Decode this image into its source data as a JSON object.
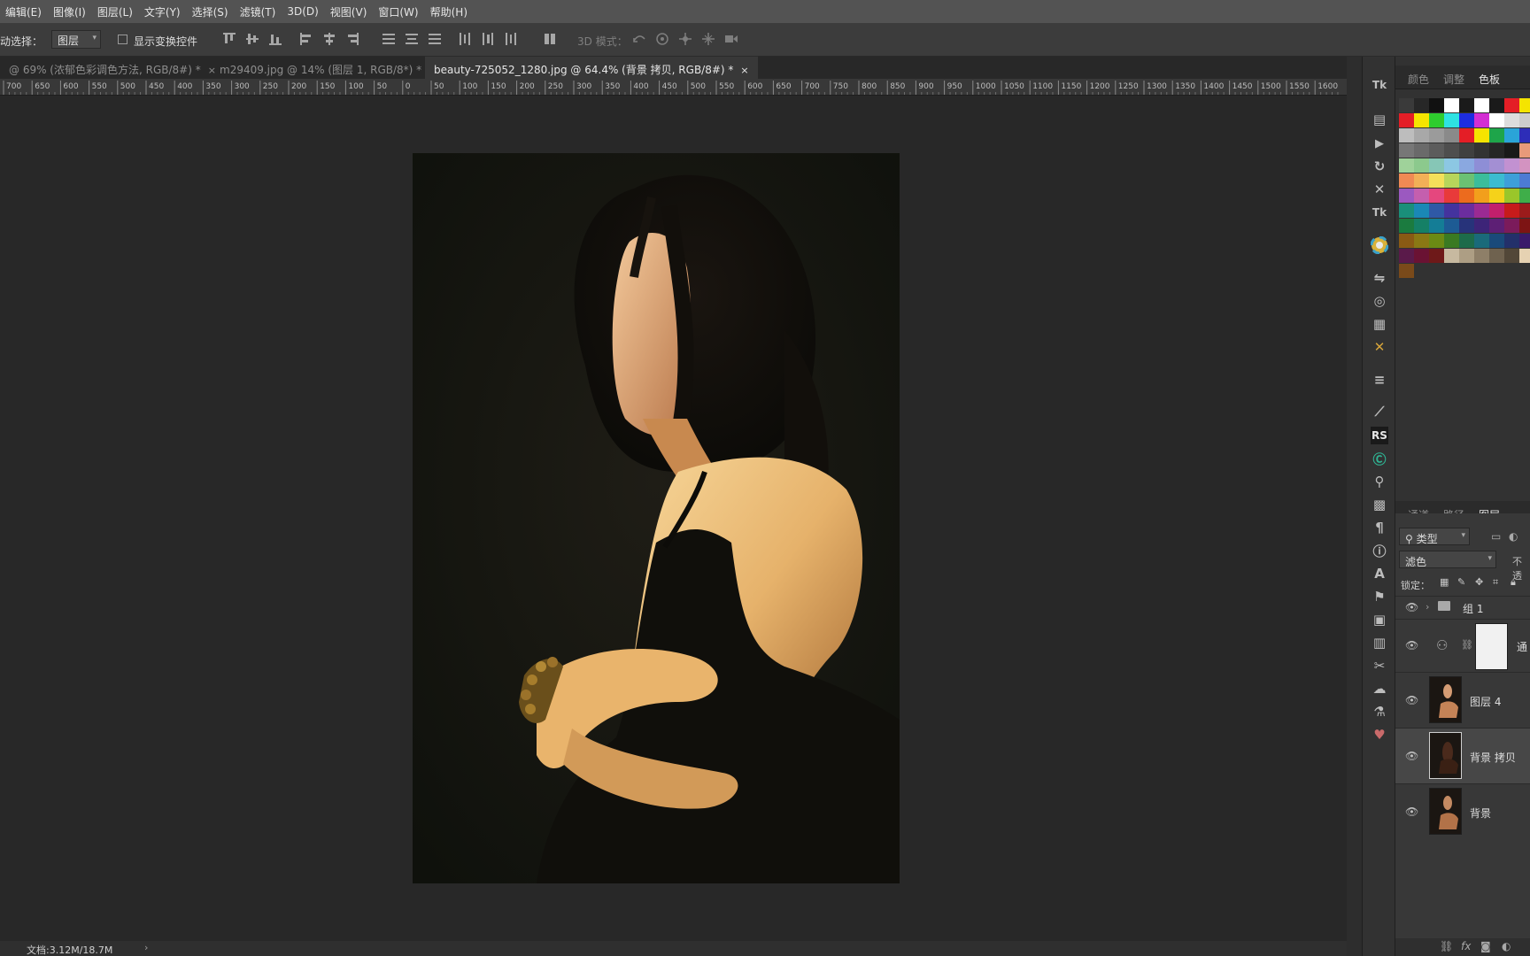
{
  "menu": [
    "编辑(E)",
    "图像(I)",
    "图层(L)",
    "文字(Y)",
    "选择(S)",
    "滤镜(T)",
    "3D(D)",
    "视图(V)",
    "窗口(W)",
    "帮助(H)"
  ],
  "options": {
    "auto_select_label": "动选择：",
    "auto_select_value": "图层",
    "show_transform_label": "显示变换控件",
    "mode3d_label": "3D 模式："
  },
  "tabs": [
    {
      "label": "@ 69% (浓郁色彩调色方法, RGB/8#) *",
      "close": "×"
    },
    {
      "label": "m29409.jpg @ 14% (图层 1, RGB/8*) *",
      "close": "×"
    },
    {
      "label": "beauty-725052_1280.jpg @ 64.4% (背景 拷贝, RGB/8#) *",
      "close": "×"
    }
  ],
  "ruler_labels": [
    "700",
    "650",
    "600",
    "550",
    "500",
    "450",
    "400",
    "350",
    "300",
    "250",
    "200",
    "150",
    "100",
    "50",
    "0",
    "50",
    "100",
    "150",
    "200",
    "250",
    "300",
    "350",
    "400",
    "450",
    "500",
    "550",
    "600",
    "650",
    "700",
    "750",
    "800",
    "850",
    "900",
    "950",
    "1000",
    "1050",
    "1100",
    "1150",
    "1200",
    "1250",
    "1300",
    "1350",
    "1400",
    "1450",
    "1500",
    "1550",
    "1600"
  ],
  "status": {
    "doc": "文档:3.12M/18.7M",
    "arrow": "›"
  },
  "side_tool_labels": {
    "rs": "RS",
    "tk1": "Tk",
    "tk2": "Tk"
  },
  "top_panel_tabs": [
    "颜色",
    "调整",
    "色板"
  ],
  "layers_panel_tabs": [
    "通道",
    "路径",
    "图层"
  ],
  "layers": {
    "filter_value": "类型",
    "blend_mode": "滤色",
    "opacity_label": "不透",
    "lock_label": "锁定：",
    "items": [
      {
        "name": "组 1",
        "type": "group"
      },
      {
        "name": "通",
        "type": "adjustment"
      },
      {
        "name": "图层 4",
        "type": "pixel"
      },
      {
        "name": "背景 拷贝",
        "type": "pixel",
        "selected": true
      },
      {
        "name": "背景",
        "type": "pixel"
      }
    ]
  },
  "footer_icons": [
    "link-icon",
    "fx",
    "mask-icon",
    "adjust-icon"
  ],
  "footer_fx": "fx",
  "colors": {
    "menubar": "#535353",
    "options": "#3c3c3c",
    "canvas_bg": "#282828",
    "panel": "#323232"
  }
}
